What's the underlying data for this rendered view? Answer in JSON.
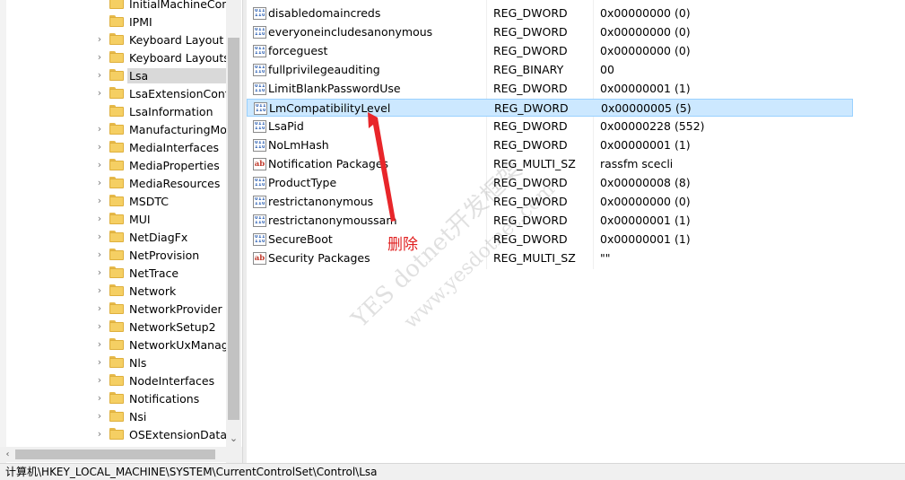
{
  "tree": {
    "items": [
      {
        "label": "InitialMachineConf",
        "expandable": false,
        "selected": false
      },
      {
        "label": "IPMI",
        "expandable": false,
        "selected": false
      },
      {
        "label": "Keyboard Layout",
        "expandable": true,
        "selected": false
      },
      {
        "label": "Keyboard Layouts",
        "expandable": true,
        "selected": false
      },
      {
        "label": "Lsa",
        "expandable": true,
        "selected": true
      },
      {
        "label": "LsaExtensionConfig",
        "expandable": true,
        "selected": false
      },
      {
        "label": "LsaInformation",
        "expandable": false,
        "selected": false
      },
      {
        "label": "ManufacturingMod",
        "expandable": true,
        "selected": false
      },
      {
        "label": "MediaInterfaces",
        "expandable": true,
        "selected": false
      },
      {
        "label": "MediaProperties",
        "expandable": true,
        "selected": false
      },
      {
        "label": "MediaResources",
        "expandable": true,
        "selected": false
      },
      {
        "label": "MSDTC",
        "expandable": true,
        "selected": false
      },
      {
        "label": "MUI",
        "expandable": true,
        "selected": false
      },
      {
        "label": "NetDiagFx",
        "expandable": true,
        "selected": false
      },
      {
        "label": "NetProvision",
        "expandable": true,
        "selected": false
      },
      {
        "label": "NetTrace",
        "expandable": true,
        "selected": false
      },
      {
        "label": "Network",
        "expandable": true,
        "selected": false
      },
      {
        "label": "NetworkProvider",
        "expandable": true,
        "selected": false
      },
      {
        "label": "NetworkSetup2",
        "expandable": true,
        "selected": false
      },
      {
        "label": "NetworkUxManage",
        "expandable": true,
        "selected": false
      },
      {
        "label": "Nls",
        "expandable": true,
        "selected": false
      },
      {
        "label": "NodeInterfaces",
        "expandable": true,
        "selected": false
      },
      {
        "label": "Notifications",
        "expandable": true,
        "selected": false
      },
      {
        "label": "Nsi",
        "expandable": true,
        "selected": false
      },
      {
        "label": "OSExtensionDatab",
        "expandable": true,
        "selected": false
      }
    ]
  },
  "values": [
    {
      "name": "disabledomaincreds",
      "type": "REG_DWORD",
      "data": "0x00000000 (0)",
      "icon": "binary-value-icon",
      "selected": false
    },
    {
      "name": "everyoneincludesanonymous",
      "type": "REG_DWORD",
      "data": "0x00000000 (0)",
      "icon": "binary-value-icon",
      "selected": false
    },
    {
      "name": "forceguest",
      "type": "REG_DWORD",
      "data": "0x00000000 (0)",
      "icon": "binary-value-icon",
      "selected": false
    },
    {
      "name": "fullprivilegeauditing",
      "type": "REG_BINARY",
      "data": "00",
      "icon": "binary-value-icon",
      "selected": false
    },
    {
      "name": "LimitBlankPasswordUse",
      "type": "REG_DWORD",
      "data": "0x00000001 (1)",
      "icon": "binary-value-icon",
      "selected": false
    },
    {
      "name": "LmCompatibilityLevel",
      "type": "REG_DWORD",
      "data": "0x00000005 (5)",
      "icon": "binary-value-icon",
      "selected": true
    },
    {
      "name": "LsaPid",
      "type": "REG_DWORD",
      "data": "0x00000228 (552)",
      "icon": "binary-value-icon",
      "selected": false
    },
    {
      "name": "NoLmHash",
      "type": "REG_DWORD",
      "data": "0x00000001 (1)",
      "icon": "binary-value-icon",
      "selected": false
    },
    {
      "name": "Notification Packages",
      "type": "REG_MULTI_SZ",
      "data": "rassfm scecli",
      "icon": "string-value-icon",
      "selected": false
    },
    {
      "name": "ProductType",
      "type": "REG_DWORD",
      "data": "0x00000008 (8)",
      "icon": "binary-value-icon",
      "selected": false
    },
    {
      "name": "restrictanonymous",
      "type": "REG_DWORD",
      "data": "0x00000000 (0)",
      "icon": "binary-value-icon",
      "selected": false
    },
    {
      "name": "restrictanonymoussam",
      "type": "REG_DWORD",
      "data": "0x00000001 (1)",
      "icon": "binary-value-icon",
      "selected": false
    },
    {
      "name": "SecureBoot",
      "type": "REG_DWORD",
      "data": "0x00000001 (1)",
      "icon": "binary-value-icon",
      "selected": false
    },
    {
      "name": "Security Packages",
      "type": "REG_MULTI_SZ",
      "data": "\"\"",
      "icon": "string-value-icon",
      "selected": false
    }
  ],
  "string_icon_glyph": "ab",
  "binary_icon_glyph_top": "011",
  "binary_icon_glyph_bottom": "110",
  "status_bar": {
    "path": "计算机\\HKEY_LOCAL_MACHINE\\SYSTEM\\CurrentControlSet\\Control\\Lsa"
  },
  "annotation": {
    "text": "删除",
    "color": "#e02020"
  },
  "watermark": {
    "line1": "YES dotnet开发框架",
    "line2": "www.yesdotnet.com"
  },
  "colors": {
    "selection_bg": "#cce8ff",
    "selection_border": "#99d1ff",
    "folder": "#f5cf63"
  }
}
